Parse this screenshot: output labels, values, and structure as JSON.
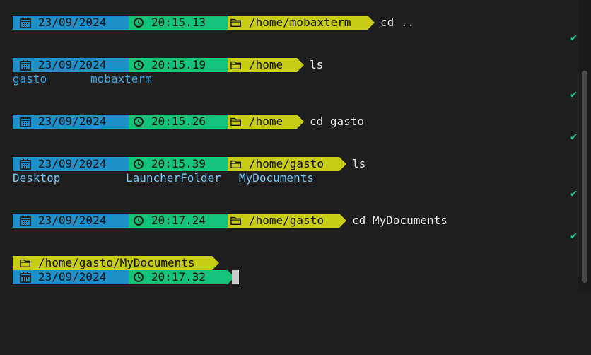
{
  "blocks": [
    {
      "date": "23/09/2024",
      "time": "20:15.13",
      "path": "/home/mobaxterm",
      "command": "cd ..",
      "output": []
    },
    {
      "date": "23/09/2024",
      "time": "20:15.19",
      "path": "/home",
      "command": "ls",
      "output": [
        "gasto",
        "mobaxterm"
      ]
    },
    {
      "date": "23/09/2024",
      "time": "20:15.26",
      "path": "/home",
      "command": "cd gasto",
      "output": []
    },
    {
      "date": "23/09/2024",
      "time": "20:15.39",
      "path": "/home/gasto",
      "command": "ls",
      "output": [
        "Desktop",
        "LauncherFolder",
        "MyDocuments"
      ]
    },
    {
      "date": "23/09/2024",
      "time": "20:17.24",
      "path": "/home/gasto",
      "command": "cd MyDocuments",
      "output": []
    }
  ],
  "current": {
    "path": "/home/gasto/MyDocuments",
    "date": "23/09/2024",
    "time": "20:17.32"
  },
  "status_check": "✔",
  "icons": {
    "date": "calendar-icon",
    "time": "clock-icon",
    "path": "folder-icon"
  },
  "colors": {
    "background": "#1e1e1e",
    "date_segment": "#1e90c9",
    "time_segment": "#15c27a",
    "path_segment": "#c7cc15",
    "dir_output": "#3aa8e8",
    "check": "#1fd18a"
  }
}
